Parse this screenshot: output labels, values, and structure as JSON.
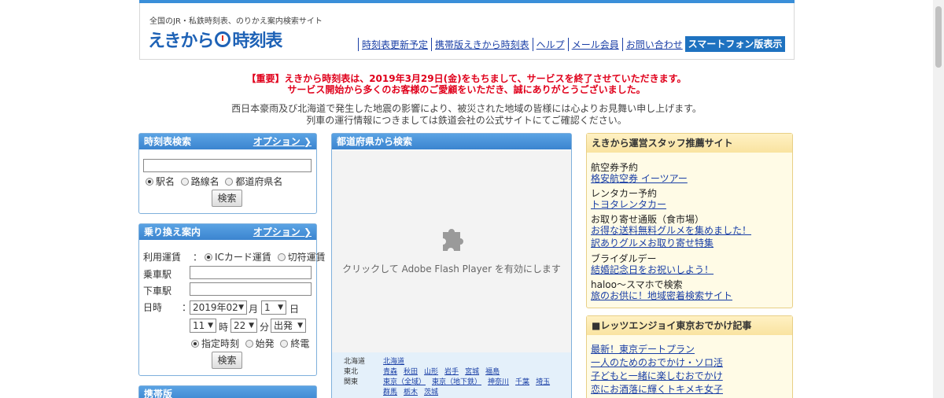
{
  "header": {
    "tagline": "全国のJR・私鉄時刻表、のりかえ案内検索サイト",
    "logo_left": "えきから",
    "logo_right": "時刻表",
    "nav": [
      "時刻表更新予定",
      "携帯版えきから時刻表",
      "ヘルプ",
      "メール会員",
      "お問い合わせ"
    ],
    "smartphone_button": "スマートフォン版表示"
  },
  "notices": {
    "important_line1": "【重要】えきから時刻表は、2019年3月29日(金)をもちまして、サービスを終了させていただきます。",
    "important_line2": "サービス開始から多くのお客様のご愛顧をいただき、誠にありがとうございました。",
    "info_line1": "西日本豪雨及び北海道で発生した地震の影響により、被災された地域の皆様には心よりお見舞い申し上げます。",
    "info_line2": "列車の運行情報につきましては鉄道会社の公式サイトにてご確認ください。"
  },
  "timetable_search": {
    "title": "時刻表検索",
    "option_link": "オプション ❯",
    "radios": [
      "駅名",
      "路線名",
      "都道府県名"
    ],
    "button": "検索"
  },
  "transfer": {
    "title": "乗り換え案内",
    "option_link": "オプション ❯",
    "fare_label": "利用運賃",
    "fare_sep": "：",
    "fare_options": [
      "ICカード運賃",
      "切符運賃"
    ],
    "from_label": "乗車駅",
    "to_label": "下車駅",
    "datetime_label": "日時",
    "datetime_sep": "：",
    "year_month": "2019年02",
    "month_unit": "月",
    "day": "1",
    "day_unit": "日",
    "hour": "11",
    "hour_unit": "時",
    "minute": "22",
    "minute_unit": "分",
    "mode": "出発",
    "time_options": [
      "指定時刻",
      "始発",
      "終電"
    ],
    "button": "検索"
  },
  "mobile_panel": {
    "title": "携帯版"
  },
  "prefecture": {
    "title": "都道府県から検索",
    "flash_message": "クリックして Adobe Flash Player を有効にします",
    "rows": [
      {
        "region": "北海道",
        "prefs": [
          "北海道"
        ]
      },
      {
        "region": "東北",
        "prefs": [
          "青森",
          "秋田",
          "山形",
          "岩手",
          "宮城",
          "福島"
        ]
      },
      {
        "region": "関東",
        "prefs": [
          "東京（全域）",
          "東京（地下鉄）",
          "神奈川",
          "千葉",
          "埼玉"
        ]
      },
      {
        "region": "",
        "prefs": [
          "群馬",
          "栃木",
          "茨城"
        ]
      }
    ]
  },
  "recommend": {
    "title": "えきから運営スタッフ推薦サイト",
    "items": [
      {
        "cat": "航空券予約",
        "link": "格安航空券 イーツアー"
      },
      {
        "cat": "レンタカー予約",
        "link": "トヨタレンタカー"
      },
      {
        "cat": "お取り寄せ通販（食市場）",
        "link": "お得な送料無料グルメを集めました！",
        "link2": "訳ありグルメお取り寄せ特集"
      },
      {
        "cat": "ブライダルデー",
        "link": "結婚記念日をお祝いしよう！"
      },
      {
        "cat": "haloo〜スマホで検索",
        "link": "旅のお供に！地域密着検索サイト"
      }
    ]
  },
  "tokyo": {
    "title": "■レッツエンジョイ東京おでかけ記事",
    "links": [
      "最新！東京デートプラン",
      "一人のためのおでかけ・ソロ活",
      "子どもと一緒に楽しむおでかけ",
      "恋にお酒落に輝くトキメキ女子"
    ]
  }
}
